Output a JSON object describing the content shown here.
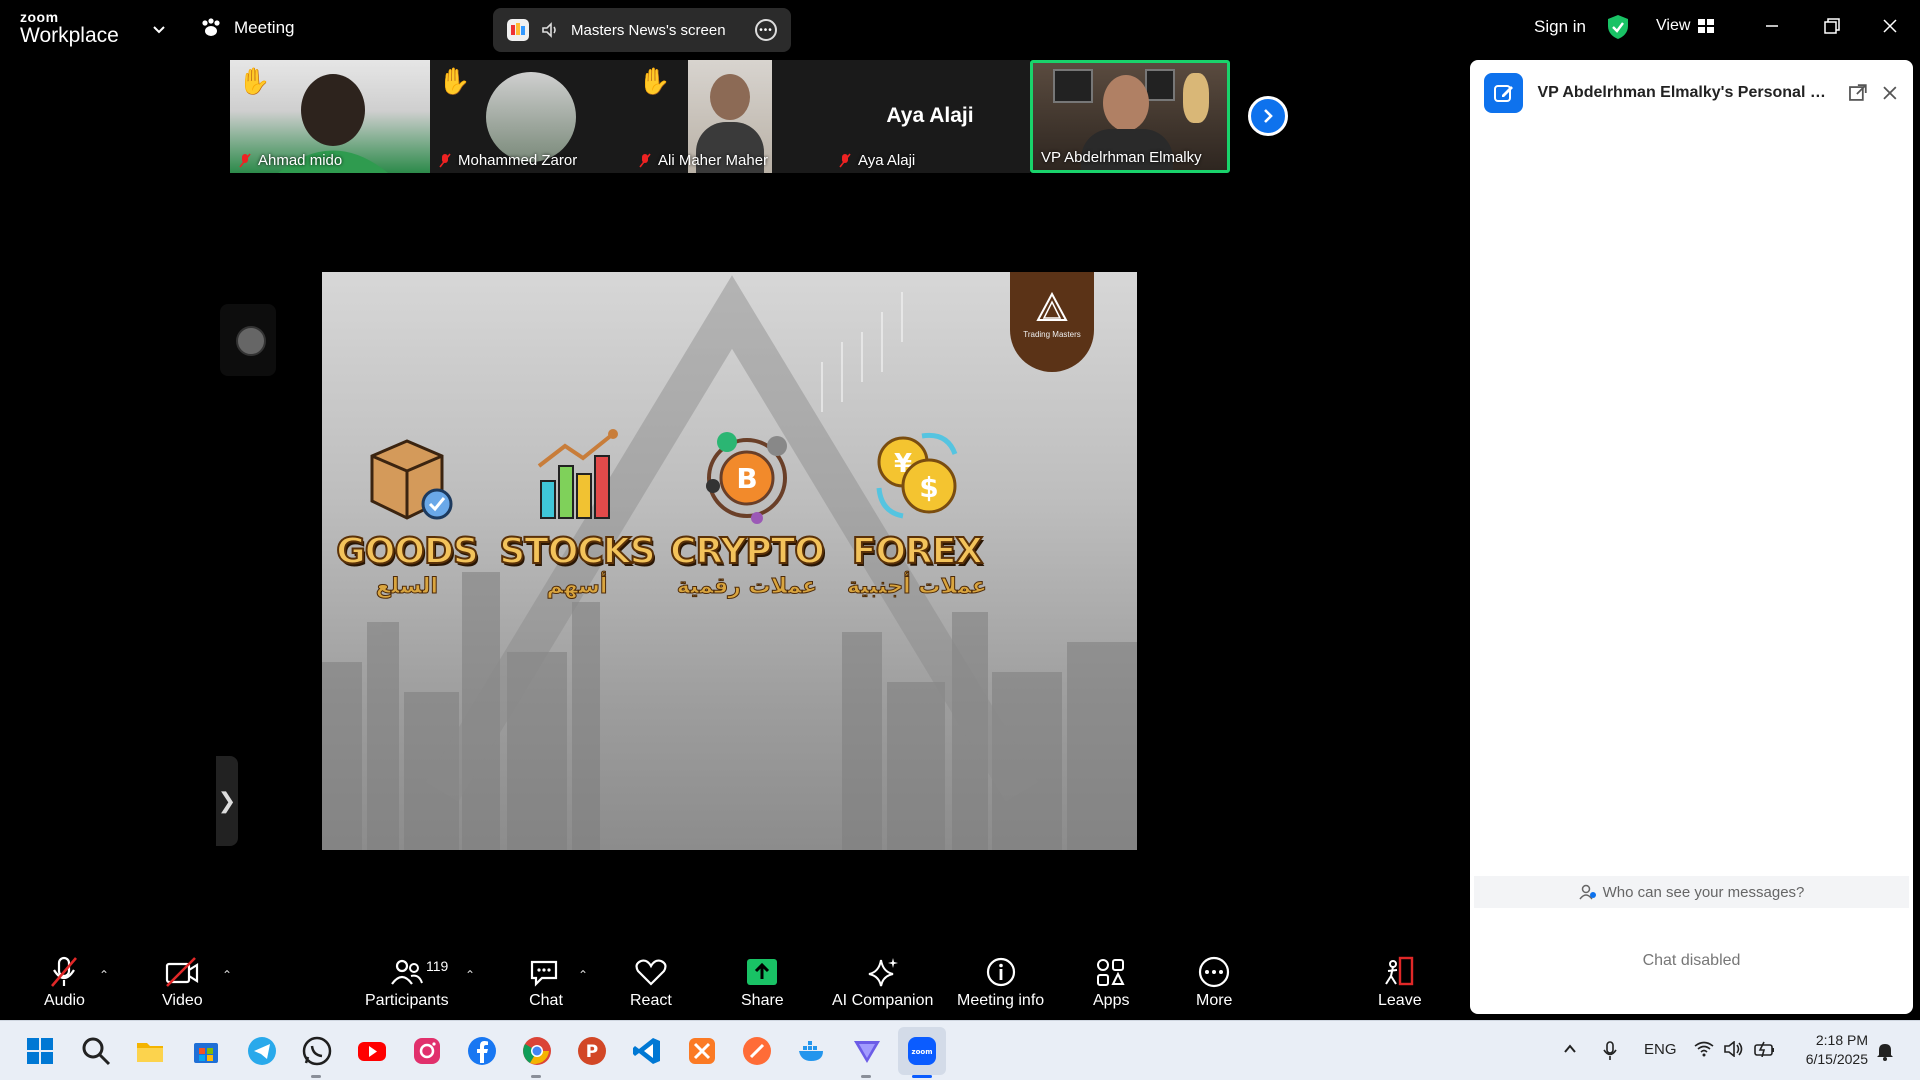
{
  "titlebar": {
    "brand_top": "zoom",
    "brand_bottom": "Workplace",
    "meeting_label": "Meeting",
    "screen_share_label": "Masters News's screen",
    "sign_in": "Sign in",
    "view": "View"
  },
  "participants_strip": [
    {
      "name": "Ahmad mido",
      "hand_raised": true,
      "muted": true
    },
    {
      "name": "Mohammed Zaror",
      "hand_raised": true,
      "muted": true
    },
    {
      "name": "Ali Maher Maher",
      "hand_raised": true,
      "muted": true
    },
    {
      "name": "Aya Alaji",
      "display_name": "Aya Alaji",
      "hand_raised": false,
      "muted": true
    },
    {
      "name": "VP Abdelrhman Elmalky",
      "hand_raised": false,
      "muted": false,
      "active_speaker": true
    }
  ],
  "slide": {
    "logo_text": "Trading Masters",
    "categories": [
      {
        "en": "GOODS",
        "ar": "السلع",
        "icon": "box-icon"
      },
      {
        "en": "STOCKS",
        "ar": "أسهم",
        "icon": "bar-chart-icon"
      },
      {
        "en": "CRYPTO",
        "ar": "عملات رقمية",
        "icon": "bitcoin-icon"
      },
      {
        "en": "FOREX",
        "ar": "عملات أجنبية",
        "icon": "currency-exchange-icon"
      }
    ]
  },
  "chat": {
    "title": "VP Abdelrhman Elmalky's Personal M...",
    "who_can_see": "Who can see your messages?",
    "status": "Chat disabled"
  },
  "toolbar": {
    "audio": "Audio",
    "video": "Video",
    "participants": "Participants",
    "participant_count": "119",
    "chat": "Chat",
    "react": "React",
    "share": "Share",
    "ai_companion": "AI Companion",
    "meeting_info": "Meeting info",
    "apps": "Apps",
    "more": "More",
    "leave": "Leave"
  },
  "taskbar": {
    "language": "ENG",
    "time": "2:18 PM",
    "date": "6/15/2025",
    "apps": [
      "start-icon",
      "search-icon",
      "file-explorer-icon",
      "microsoft-store-icon",
      "telegram-icon",
      "whatsapp-icon",
      "youtube-icon",
      "instagram-icon",
      "facebook-icon",
      "chrome-icon",
      "powerpoint-icon",
      "vscode-icon",
      "xampp-icon",
      "postman-icon",
      "docker-icon",
      "vpn-icon",
      "zoom-icon"
    ]
  },
  "colors": {
    "accent_blue": "#0e72ed",
    "active_speaker_green": "#19d36b",
    "share_green": "#19c265",
    "leave_red": "#e02828",
    "badge_brown": "#5b3317"
  }
}
